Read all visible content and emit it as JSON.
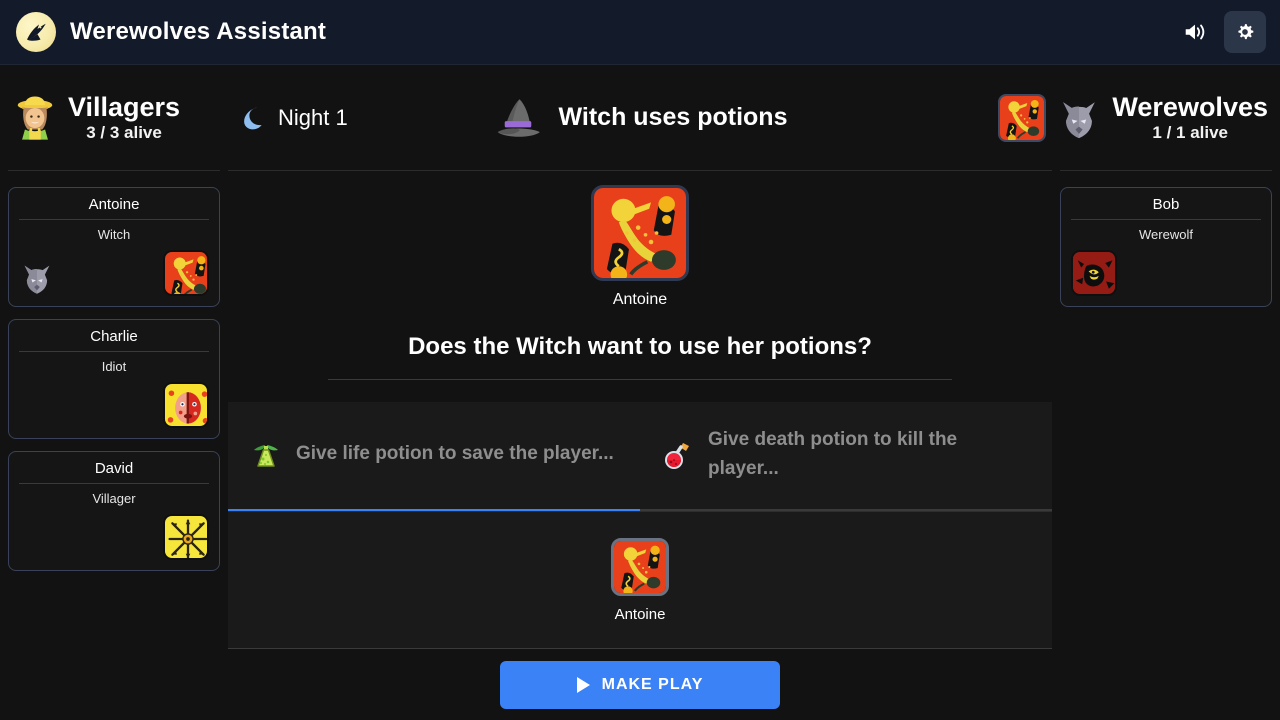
{
  "app": {
    "title": "Werewolves Assistant",
    "logo_icon": "moon-wolf-logo",
    "sound_icon": "speaker-icon",
    "settings_icon": "gear-icon"
  },
  "villagers_panel": {
    "team_emoji": "farmer-emoji",
    "team_name": "Villagers",
    "alive": "3 / 3 alive",
    "players": [
      {
        "name": "Antoine",
        "role": "Witch",
        "card_icon": "witch-card",
        "has_wolf_mark": true
      },
      {
        "name": "Charlie",
        "role": "Idiot",
        "card_icon": "idiot-card",
        "has_wolf_mark": false
      },
      {
        "name": "David",
        "role": "Villager",
        "card_icon": "villager-card",
        "has_wolf_mark": false
      }
    ]
  },
  "werewolves_panel": {
    "team_emoji": "wolf-emoji",
    "team_name": "Werewolves",
    "alive": "1 / 1 alive",
    "head_card_icon": "witch-card",
    "players": [
      {
        "name": "Bob",
        "role": "Werewolf",
        "card_icon": "werewolf-card",
        "has_wolf_mark": false
      }
    ]
  },
  "phase": {
    "moon_icon": "crescent-moon-icon",
    "label": "Night 1"
  },
  "step": {
    "icon": "witch-hat-icon",
    "title": "Witch uses potions"
  },
  "target": {
    "card_icon": "witch-card",
    "name": "Antoine"
  },
  "question": "Does the Witch want to use her potions?",
  "tabs": [
    {
      "icon": "life-potion-icon",
      "label": "Give life potion to save the player...",
      "active": true
    },
    {
      "icon": "death-potion-icon",
      "label": "Give death potion to kill the player...",
      "active": false
    }
  ],
  "choice": {
    "card_icon": "witch-card",
    "name": "Antoine"
  },
  "footer": {
    "play_label": "MAKE PLAY",
    "play_icon": "play-triangle-icon"
  },
  "colors": {
    "accent_blue": "#3b82f6",
    "topbar": "#131a2a",
    "background": "#121212",
    "panel": "#1a1a1a",
    "card_border": "#394258",
    "muted_text": "#8e8e8e"
  }
}
